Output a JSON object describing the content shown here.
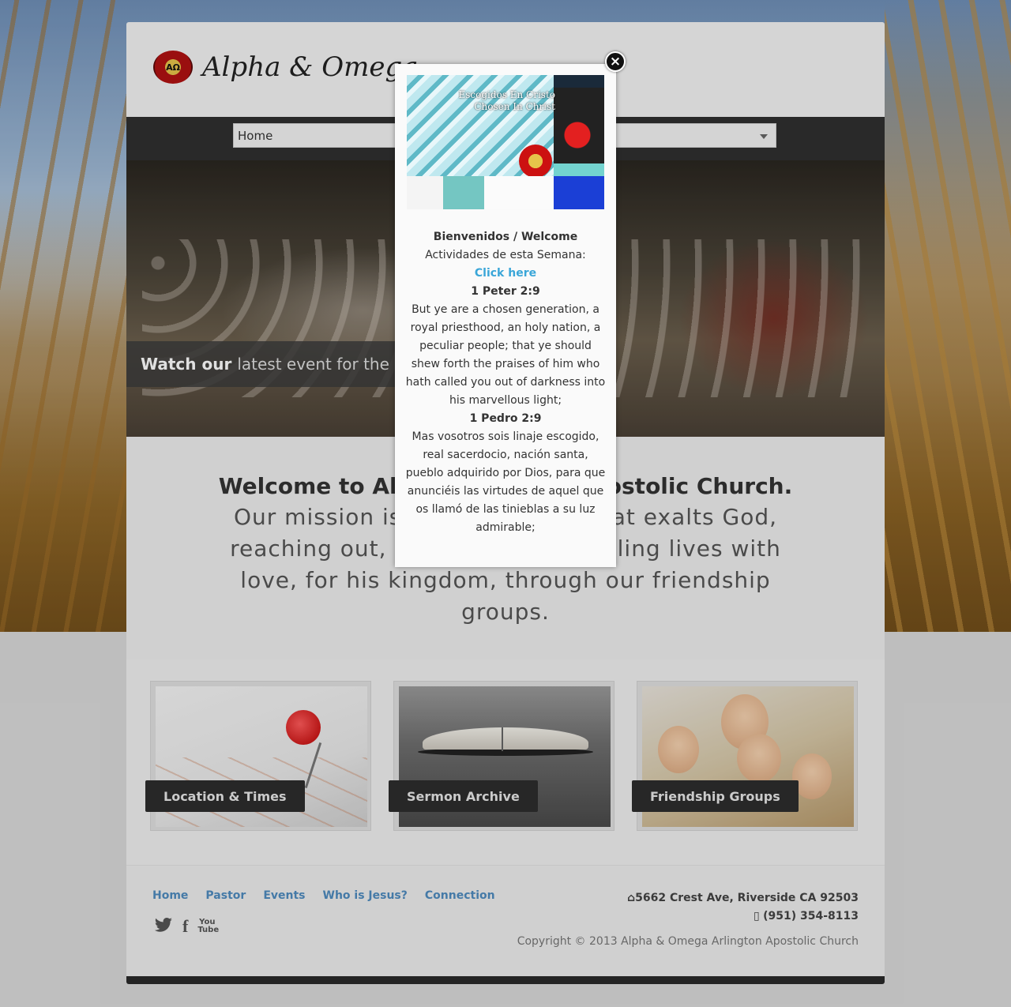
{
  "header": {
    "logo_badge": "AΩ",
    "logo_text": "Alpha & Omega"
  },
  "nav": {
    "select_value": "Home"
  },
  "hero": {
    "caption_bold": "Watch our",
    "caption_rest": "latest event for the"
  },
  "welcome": {
    "title": "Welcome to Alpha & Omega Apostolic Church.",
    "mission": "Our mission is to be a church that exalts God, reaching out, reaching all, discipling lives with love, for his kingdom, through our friendship groups."
  },
  "cards": [
    {
      "label": "Location & Times"
    },
    {
      "label": "Sermon Archive"
    },
    {
      "label": "Friendship Groups"
    }
  ],
  "footer": {
    "nav": [
      "Home",
      "Pastor",
      "Events",
      "Who is Jesus?",
      "Connection"
    ],
    "address": "5662 Crest Ave, Riverside CA 92503",
    "phone": "(951) 354-8113",
    "copyright": "Copyright © 2013 Alpha & Omega Arlington Apostolic Church",
    "social_icons": [
      "twitter-icon",
      "facebook-icon",
      "youtube-icon"
    ],
    "youtube_label": "You Tube",
    "facebook_label": "f"
  },
  "modal": {
    "close_label": "×",
    "flyer_title_1": "Escogidos En Cristo",
    "flyer_title_2": "Chosen In Christ",
    "heading": "Bienvenidos / Welcome",
    "activities": "Actividades de esta Semana:",
    "link": "Click here",
    "verse_ref_en": "1 Peter 2:9",
    "verse_en": "But ye are a chosen generation, a royal priesthood, an holy nation, a peculiar people; that ye should shew forth the praises of him who hath called you out of darkness into his marvellous light;",
    "verse_ref_es": "1 Pedro 2:9",
    "verse_es": "Mas vosotros sois linaje escogido, real sacerdocio, nación santa, pueblo adquirido por Dios, para que anunciéis las virtudes de aquel que os llamó de las tinieblas a su luz admirable;"
  },
  "colors": {
    "link_blue": "#4f8bbf",
    "modal_link": "#3aa6d8",
    "nav_bar": "#2f2f2f"
  }
}
